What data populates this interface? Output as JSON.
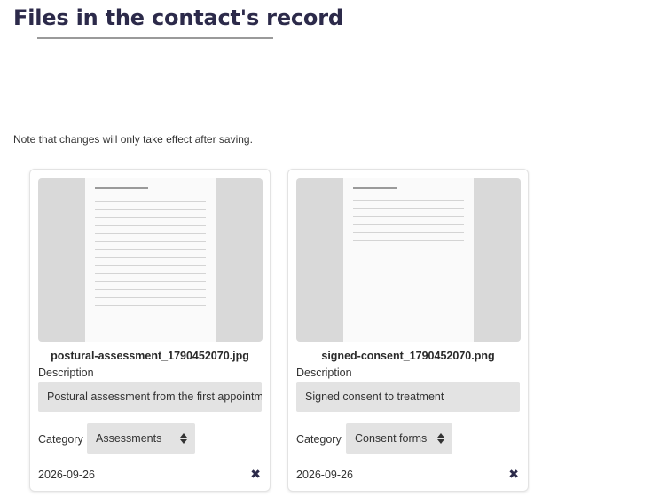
{
  "header": {
    "title": "Files in the contact's record"
  },
  "note": "Note that changes will only take effect after saving.",
  "files": [
    {
      "filename": "postural-assessment_1790452070.jpg",
      "description_label": "Description",
      "description_value": "Postural assessment from the first appointment",
      "category_label": "Category",
      "category_value": "Assessments",
      "date": "2026-09-26",
      "remove_icon": "close-icon"
    },
    {
      "filename": "signed-consent_1790452070.png",
      "description_label": "Description",
      "description_value": "Signed consent to treatment",
      "category_label": "Category",
      "category_value": "Consent forms",
      "date": "2026-09-26",
      "remove_icon": "close-icon"
    }
  ],
  "colors": {
    "title": "#2c2a4a",
    "field_background": "#e3e3e3",
    "thumbnail_background": "#d9d9d9"
  }
}
